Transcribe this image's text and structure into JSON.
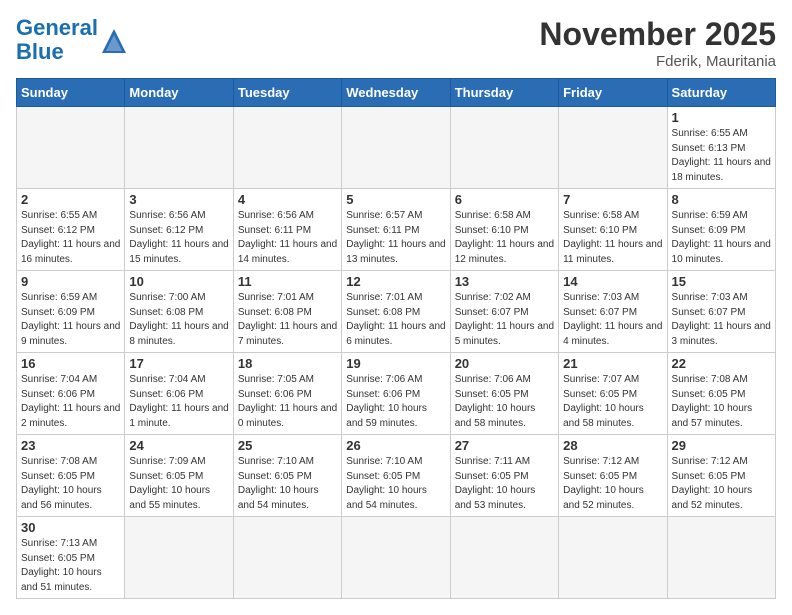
{
  "logo": {
    "general": "General",
    "blue": "Blue"
  },
  "title": "November 2025",
  "subtitle": "Fderik, Mauritania",
  "weekdays": [
    "Sunday",
    "Monday",
    "Tuesday",
    "Wednesday",
    "Thursday",
    "Friday",
    "Saturday"
  ],
  "weeks": [
    [
      {
        "day": "",
        "info": ""
      },
      {
        "day": "",
        "info": ""
      },
      {
        "day": "",
        "info": ""
      },
      {
        "day": "",
        "info": ""
      },
      {
        "day": "",
        "info": ""
      },
      {
        "day": "",
        "info": ""
      },
      {
        "day": "1",
        "info": "Sunrise: 6:55 AM\nSunset: 6:13 PM\nDaylight: 11 hours and 18 minutes."
      }
    ],
    [
      {
        "day": "2",
        "info": "Sunrise: 6:55 AM\nSunset: 6:12 PM\nDaylight: 11 hours and 16 minutes."
      },
      {
        "day": "3",
        "info": "Sunrise: 6:56 AM\nSunset: 6:12 PM\nDaylight: 11 hours and 15 minutes."
      },
      {
        "day": "4",
        "info": "Sunrise: 6:56 AM\nSunset: 6:11 PM\nDaylight: 11 hours and 14 minutes."
      },
      {
        "day": "5",
        "info": "Sunrise: 6:57 AM\nSunset: 6:11 PM\nDaylight: 11 hours and 13 minutes."
      },
      {
        "day": "6",
        "info": "Sunrise: 6:58 AM\nSunset: 6:10 PM\nDaylight: 11 hours and 12 minutes."
      },
      {
        "day": "7",
        "info": "Sunrise: 6:58 AM\nSunset: 6:10 PM\nDaylight: 11 hours and 11 minutes."
      },
      {
        "day": "8",
        "info": "Sunrise: 6:59 AM\nSunset: 6:09 PM\nDaylight: 11 hours and 10 minutes."
      }
    ],
    [
      {
        "day": "9",
        "info": "Sunrise: 6:59 AM\nSunset: 6:09 PM\nDaylight: 11 hours and 9 minutes."
      },
      {
        "day": "10",
        "info": "Sunrise: 7:00 AM\nSunset: 6:08 PM\nDaylight: 11 hours and 8 minutes."
      },
      {
        "day": "11",
        "info": "Sunrise: 7:01 AM\nSunset: 6:08 PM\nDaylight: 11 hours and 7 minutes."
      },
      {
        "day": "12",
        "info": "Sunrise: 7:01 AM\nSunset: 6:08 PM\nDaylight: 11 hours and 6 minutes."
      },
      {
        "day": "13",
        "info": "Sunrise: 7:02 AM\nSunset: 6:07 PM\nDaylight: 11 hours and 5 minutes."
      },
      {
        "day": "14",
        "info": "Sunrise: 7:03 AM\nSunset: 6:07 PM\nDaylight: 11 hours and 4 minutes."
      },
      {
        "day": "15",
        "info": "Sunrise: 7:03 AM\nSunset: 6:07 PM\nDaylight: 11 hours and 3 minutes."
      }
    ],
    [
      {
        "day": "16",
        "info": "Sunrise: 7:04 AM\nSunset: 6:06 PM\nDaylight: 11 hours and 2 minutes."
      },
      {
        "day": "17",
        "info": "Sunrise: 7:04 AM\nSunset: 6:06 PM\nDaylight: 11 hours and 1 minute."
      },
      {
        "day": "18",
        "info": "Sunrise: 7:05 AM\nSunset: 6:06 PM\nDaylight: 11 hours and 0 minutes."
      },
      {
        "day": "19",
        "info": "Sunrise: 7:06 AM\nSunset: 6:06 PM\nDaylight: 10 hours and 59 minutes."
      },
      {
        "day": "20",
        "info": "Sunrise: 7:06 AM\nSunset: 6:05 PM\nDaylight: 10 hours and 58 minutes."
      },
      {
        "day": "21",
        "info": "Sunrise: 7:07 AM\nSunset: 6:05 PM\nDaylight: 10 hours and 58 minutes."
      },
      {
        "day": "22",
        "info": "Sunrise: 7:08 AM\nSunset: 6:05 PM\nDaylight: 10 hours and 57 minutes."
      }
    ],
    [
      {
        "day": "23",
        "info": "Sunrise: 7:08 AM\nSunset: 6:05 PM\nDaylight: 10 hours and 56 minutes."
      },
      {
        "day": "24",
        "info": "Sunrise: 7:09 AM\nSunset: 6:05 PM\nDaylight: 10 hours and 55 minutes."
      },
      {
        "day": "25",
        "info": "Sunrise: 7:10 AM\nSunset: 6:05 PM\nDaylight: 10 hours and 54 minutes."
      },
      {
        "day": "26",
        "info": "Sunrise: 7:10 AM\nSunset: 6:05 PM\nDaylight: 10 hours and 54 minutes."
      },
      {
        "day": "27",
        "info": "Sunrise: 7:11 AM\nSunset: 6:05 PM\nDaylight: 10 hours and 53 minutes."
      },
      {
        "day": "28",
        "info": "Sunrise: 7:12 AM\nSunset: 6:05 PM\nDaylight: 10 hours and 52 minutes."
      },
      {
        "day": "29",
        "info": "Sunrise: 7:12 AM\nSunset: 6:05 PM\nDaylight: 10 hours and 52 minutes."
      }
    ],
    [
      {
        "day": "30",
        "info": "Sunrise: 7:13 AM\nSunset: 6:05 PM\nDaylight: 10 hours and 51 minutes."
      },
      {
        "day": "",
        "info": ""
      },
      {
        "day": "",
        "info": ""
      },
      {
        "day": "",
        "info": ""
      },
      {
        "day": "",
        "info": ""
      },
      {
        "day": "",
        "info": ""
      },
      {
        "day": "",
        "info": ""
      }
    ]
  ]
}
